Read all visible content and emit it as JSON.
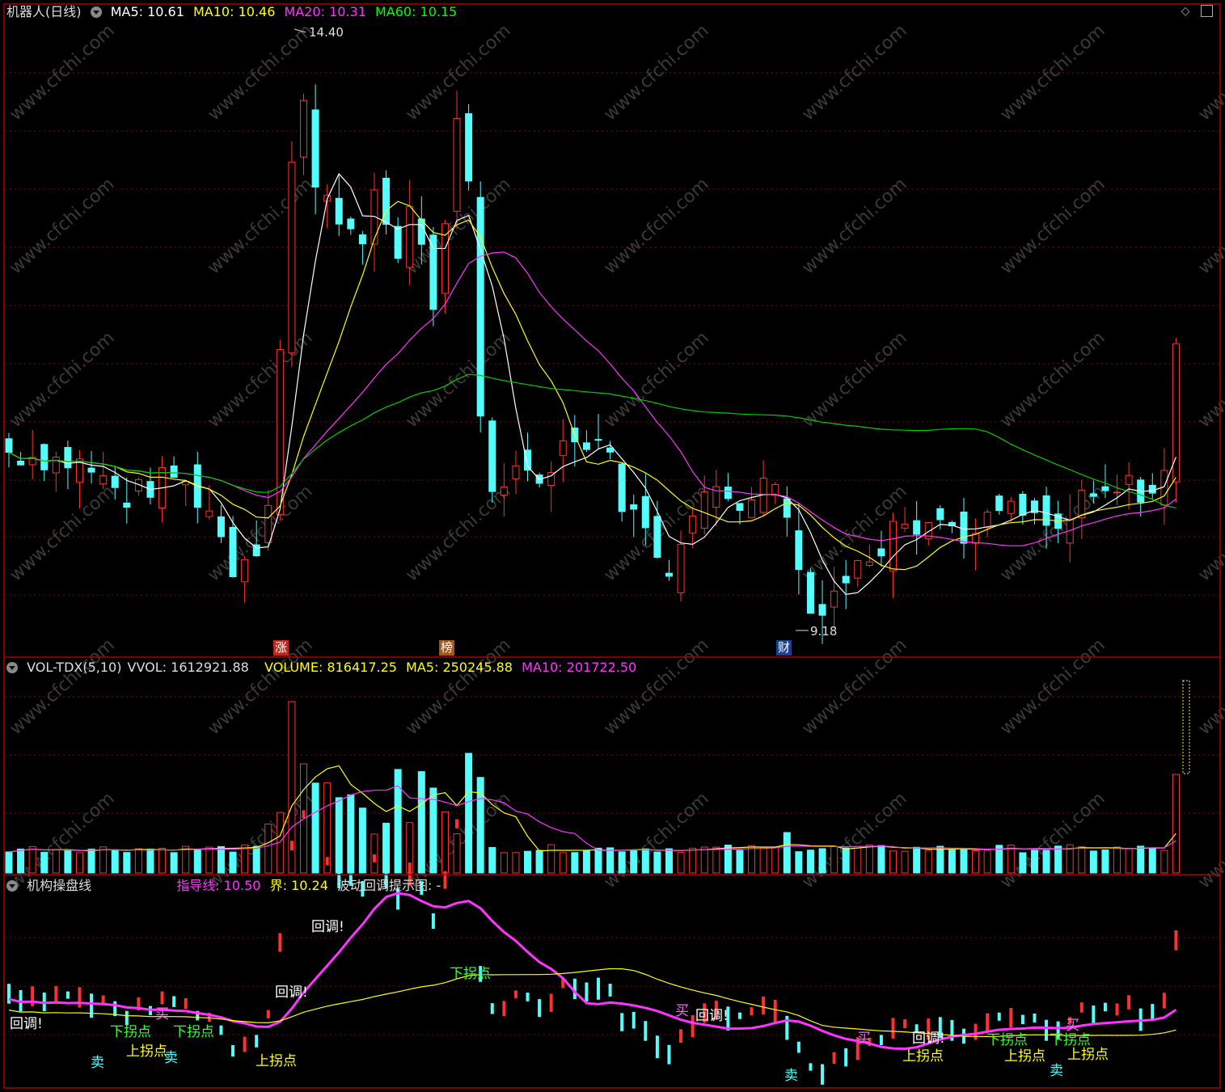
{
  "window": {
    "diamond_icon": "diamond-icon",
    "maximize_icon": "window-maximize-icon"
  },
  "main": {
    "title": "机器人(日线)",
    "indicators": [
      {
        "label": "MA5: 10.61",
        "color": "#ffffff"
      },
      {
        "label": "MA10: 10.46",
        "color": "#ffff00"
      },
      {
        "label": "MA20: 10.31",
        "color": "#ff33ff"
      },
      {
        "label": "MA60: 10.15",
        "color": "#00ff00"
      }
    ],
    "high_label": "14.40",
    "low_label": "9.18",
    "tags": [
      {
        "text": "涨",
        "bg": "#c0281e"
      },
      {
        "text": "榜",
        "bg": "#a8541c"
      },
      {
        "text": "财",
        "bg": "#1e3f8a"
      }
    ],
    "watermark": "www.cfchi.com"
  },
  "volume": {
    "title": "VOL-TDX(5,10)",
    "vvol": "VVOL: 1612921.88",
    "volume": "VOLUME: 816417.25",
    "ma5": "MA5: 250245.88",
    "ma10": "MA10: 201722.50",
    "colors": {
      "vvol": "#dddddd",
      "volume": "#ffff00",
      "ma5": "#ffff00",
      "ma10": "#ff33ff"
    }
  },
  "indicator": {
    "title": "机构操盘线",
    "guide": "指导线: 10.50",
    "bound": "界: 10.24",
    "wave": "波动回调提示图: -",
    "colors": {
      "guide": "#ff33ff",
      "bound": "#ffff00",
      "wave": "#dddddd"
    },
    "labels": {
      "pullback": "回调!",
      "down_turn": "下拐点",
      "up_turn": "上拐点",
      "buy": "买",
      "sell": "卖"
    }
  },
  "colors": {
    "up": "#ff3030",
    "down": "#54fcfc",
    "grid": "#8a0000",
    "border": "#b00000"
  }
}
